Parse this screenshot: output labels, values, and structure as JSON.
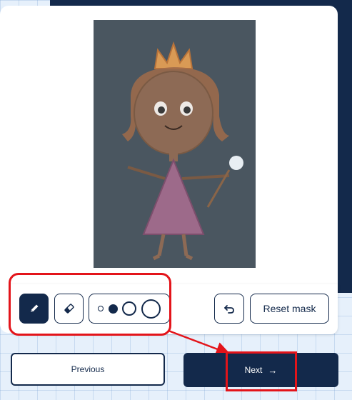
{
  "colors": {
    "navy": "#13294b",
    "annotation_red": "#e3141a",
    "background": "#e6f0fb",
    "canvas_bg": "#4a5660"
  },
  "canvas": {
    "description_icon": "child-drawing-princess"
  },
  "toolbar": {
    "pen_icon": "pencil-icon",
    "eraser_icon": "eraser-icon",
    "brush_sizes": [
      "extra-small",
      "small",
      "medium",
      "large"
    ],
    "selected_brush_size": "small",
    "undo_icon": "undo-icon",
    "reset_label": "Reset mask"
  },
  "navigation": {
    "previous_label": "Previous",
    "next_label": "Next",
    "next_arrow": "→"
  }
}
